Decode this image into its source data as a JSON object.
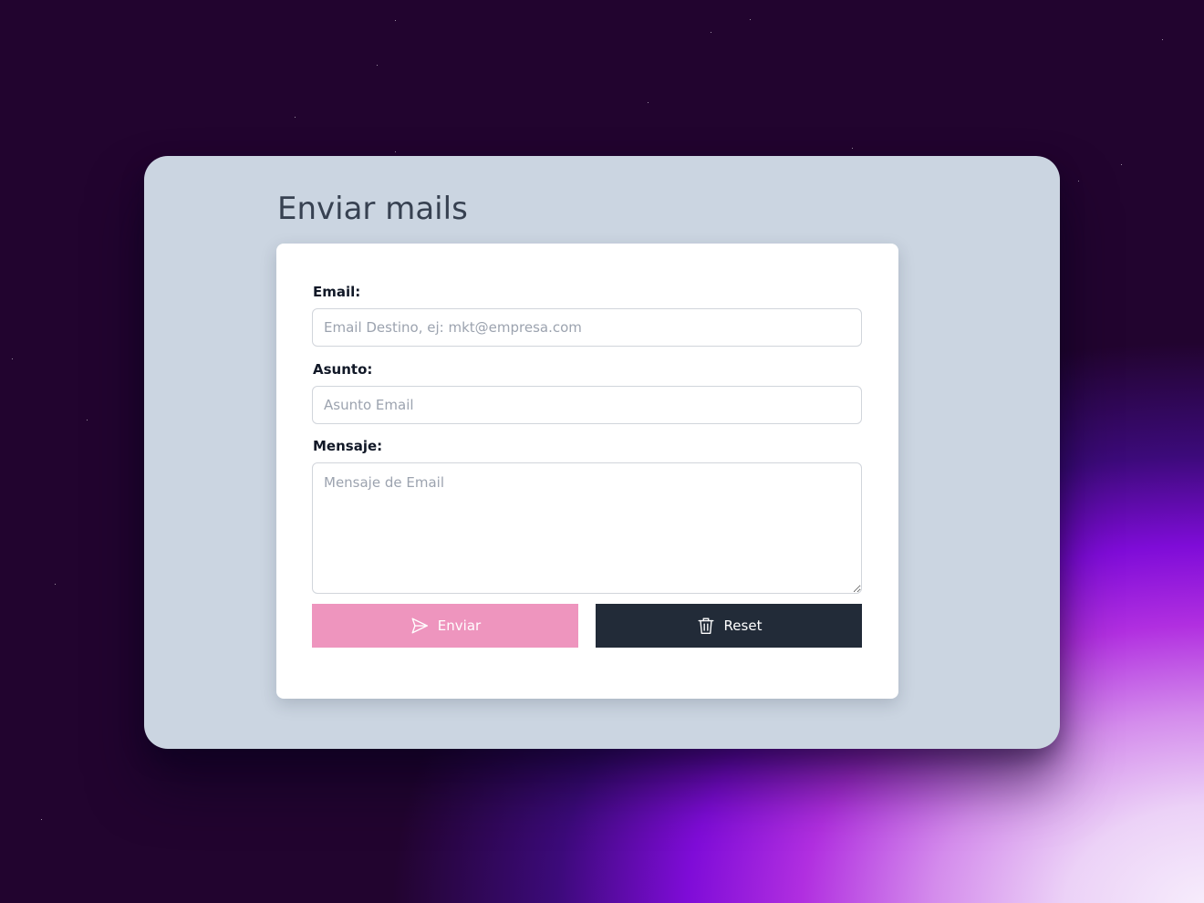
{
  "page": {
    "title": "Enviar mails"
  },
  "form": {
    "email": {
      "label": "Email:",
      "placeholder": "Email Destino, ej: mkt@empresa.com",
      "value": ""
    },
    "subject": {
      "label": "Asunto:",
      "placeholder": "Asunto Email",
      "value": ""
    },
    "message": {
      "label": "Mensaje:",
      "placeholder": "Mensaje de Email",
      "value": ""
    }
  },
  "actions": {
    "send_label": "Enviar",
    "send_icon": "send-icon",
    "reset_label": "Reset",
    "reset_icon": "trash-icon"
  },
  "colors": {
    "background": "#22042f",
    "window": "#cbd5e1",
    "card": "#ffffff",
    "send_button": "#ee95be",
    "reset_button": "#222b38",
    "title_text": "#374151"
  }
}
